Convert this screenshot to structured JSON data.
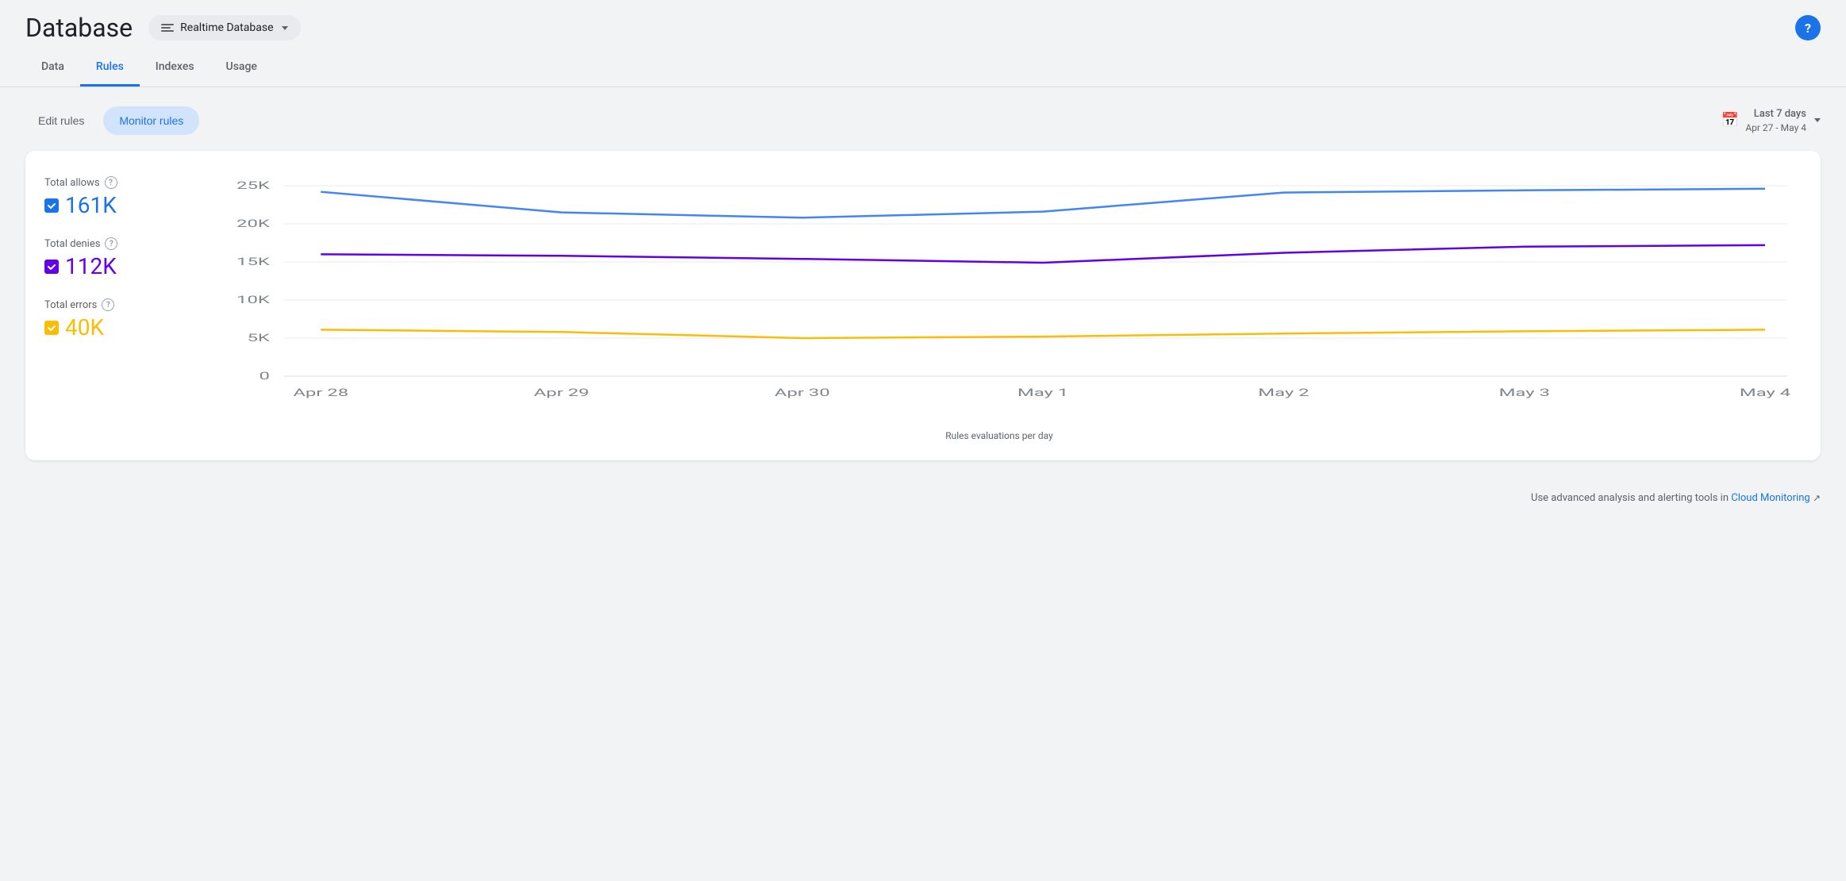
{
  "header": {
    "title": "Database",
    "db_selector_label": "Realtime Database",
    "help_label": "?"
  },
  "tabs": [
    {
      "id": "data",
      "label": "Data",
      "active": false
    },
    {
      "id": "rules",
      "label": "Rules",
      "active": true
    },
    {
      "id": "indexes",
      "label": "Indexes",
      "active": false
    },
    {
      "id": "usage",
      "label": "Usage",
      "active": false
    }
  ],
  "toolbar": {
    "edit_rules_label": "Edit rules",
    "monitor_rules_label": "Monitor rules",
    "date_range_label": "Last 7 days",
    "date_range_dates": "Apr 27 - May 4"
  },
  "chart": {
    "title": "Rules evaluations per day",
    "y_labels": [
      "25K",
      "20K",
      "15K",
      "10K",
      "5K",
      "0"
    ],
    "x_labels": [
      "Apr 28",
      "Apr 29",
      "Apr 30",
      "May 1",
      "May 2",
      "May 3",
      "May 4"
    ],
    "series": [
      {
        "id": "allows",
        "label": "Total allows",
        "value": "161K",
        "color": "#4285f4",
        "checkbox_color": "blue",
        "points": [
          24200,
          21500,
          21200,
          20800,
          21600,
          24100,
          24400,
          24600
        ]
      },
      {
        "id": "denies",
        "label": "Total denies",
        "value": "112K",
        "color": "#6200ea",
        "checkbox_color": "purple",
        "points": [
          16000,
          15800,
          15400,
          15200,
          14900,
          16200,
          17000,
          17200
        ]
      },
      {
        "id": "errors",
        "label": "Total errors",
        "value": "40K",
        "color": "#fbbc04",
        "checkbox_color": "yellow",
        "points": [
          6100,
          5800,
          5400,
          5000,
          5200,
          5600,
          5900,
          6100
        ]
      }
    ]
  },
  "footer": {
    "text": "Use advanced analysis and alerting tools in ",
    "link_label": "Cloud Monitoring",
    "external_icon": "↗"
  }
}
